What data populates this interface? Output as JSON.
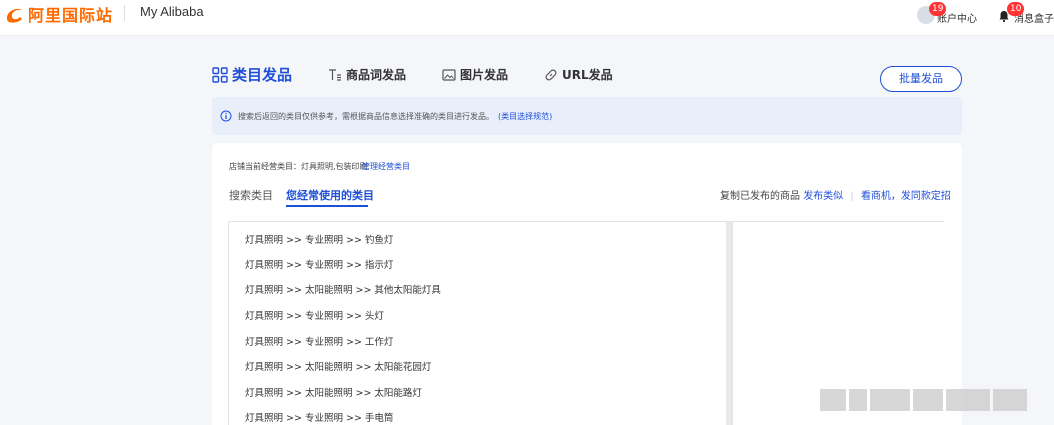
{
  "header": {
    "logo_text": "阿里国际站",
    "title": "My Alibaba",
    "account": {
      "badge": "19",
      "label": "账户中心"
    },
    "messages": {
      "badge": "10",
      "label": "消息盒子"
    }
  },
  "tabs": [
    {
      "label": "类目发品",
      "active": true,
      "icon": "grid-icon"
    },
    {
      "label": "商品词发品",
      "active": false,
      "icon": "text-list-icon"
    },
    {
      "label": "图片发品",
      "active": false,
      "icon": "image-icon"
    },
    {
      "label": "URL发品",
      "active": false,
      "icon": "link-icon"
    }
  ],
  "batch_button": "批量发品",
  "notice": {
    "text": "搜索后返回的类目仅供参考，需根据商品信息选择准确的类目进行发品。",
    "link": "(类目选择规范)"
  },
  "shop": {
    "label": "店铺当前经营类目：灯具照明,包装印刷",
    "manage_link": "管理经营类目"
  },
  "subtabs": {
    "search": "搜索类目",
    "frequent": "您经常使用的类目"
  },
  "copy": {
    "prefix": "复制已发布的商品",
    "link1": "发布类似",
    "link2": "看商机，发同款定招"
  },
  "categories": [
    "灯具照明 >> 专业照明 >> 钓鱼灯",
    "灯具照明 >> 专业照明 >> 指示灯",
    "灯具照明 >> 太阳能照明 >> 其他太阳能灯具",
    "灯具照明 >> 专业照明 >> 头灯",
    "灯具照明 >> 专业照明 >> 工作灯",
    "灯具照明 >> 太阳能照明 >> 太阳能花园灯",
    "灯具照明 >> 太阳能照明 >> 太阳能路灯",
    "灯具照明 >> 专业照明 >> 手电筒"
  ],
  "colors": {
    "accent": "#1f4fd6",
    "brand": "#ff6a00",
    "badge": "#ff3333"
  }
}
